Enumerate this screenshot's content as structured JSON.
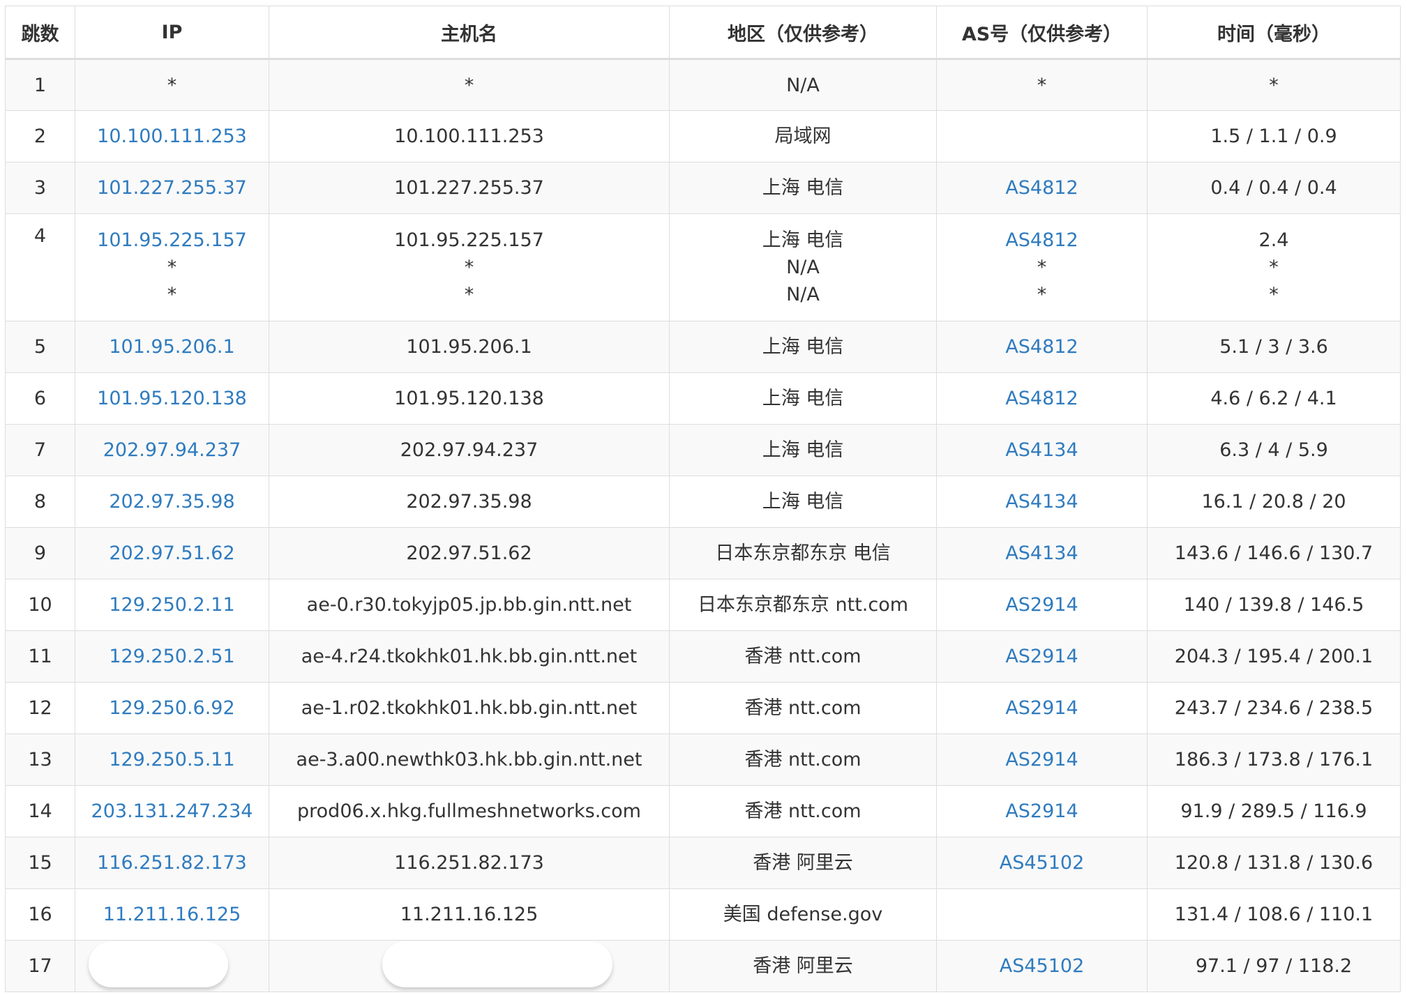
{
  "headers": [
    "跳数",
    "IP",
    "主机名",
    "地区（仅供参考）",
    "AS号（仅供参考）",
    "时间（毫秒）"
  ],
  "rows": [
    {
      "hop": "1",
      "ip": [
        "*"
      ],
      "ip_link": false,
      "host": [
        "*"
      ],
      "region": [
        "N/A"
      ],
      "asn": [
        "*"
      ],
      "asn_link": false,
      "time": [
        "*"
      ]
    },
    {
      "hop": "2",
      "ip": [
        "10.100.111.253"
      ],
      "ip_link": true,
      "host": [
        "10.100.111.253"
      ],
      "region": [
        "局域网"
      ],
      "asn": [
        ""
      ],
      "asn_link": false,
      "time": [
        "1.5 / 1.1 / 0.9"
      ]
    },
    {
      "hop": "3",
      "ip": [
        "101.227.255.37"
      ],
      "ip_link": true,
      "host": [
        "101.227.255.37"
      ],
      "region": [
        "上海 电信"
      ],
      "asn": [
        "AS4812"
      ],
      "asn_link": true,
      "time": [
        "0.4 / 0.4 / 0.4"
      ]
    },
    {
      "hop": "4",
      "ip": [
        "101.95.225.157",
        "*",
        "*"
      ],
      "ip_link": true,
      "host": [
        "101.95.225.157",
        "*",
        "*"
      ],
      "region": [
        "上海 电信",
        "N/A",
        "N/A"
      ],
      "asn": [
        "AS4812",
        "*",
        "*"
      ],
      "asn_link": true,
      "time": [
        "2.4",
        "*",
        "*"
      ]
    },
    {
      "hop": "5",
      "ip": [
        "101.95.206.1"
      ],
      "ip_link": true,
      "host": [
        "101.95.206.1"
      ],
      "region": [
        "上海 电信"
      ],
      "asn": [
        "AS4812"
      ],
      "asn_link": true,
      "time": [
        "5.1 / 3 / 3.6"
      ]
    },
    {
      "hop": "6",
      "ip": [
        "101.95.120.138"
      ],
      "ip_link": true,
      "host": [
        "101.95.120.138"
      ],
      "region": [
        "上海 电信"
      ],
      "asn": [
        "AS4812"
      ],
      "asn_link": true,
      "time": [
        "4.6 / 6.2 / 4.1"
      ]
    },
    {
      "hop": "7",
      "ip": [
        "202.97.94.237"
      ],
      "ip_link": true,
      "host": [
        "202.97.94.237"
      ],
      "region": [
        "上海 电信"
      ],
      "asn": [
        "AS4134"
      ],
      "asn_link": true,
      "time": [
        "6.3 / 4 / 5.9"
      ]
    },
    {
      "hop": "8",
      "ip": [
        "202.97.35.98"
      ],
      "ip_link": true,
      "host": [
        "202.97.35.98"
      ],
      "region": [
        "上海 电信"
      ],
      "asn": [
        "AS4134"
      ],
      "asn_link": true,
      "time": [
        "16.1 / 20.8 / 20"
      ]
    },
    {
      "hop": "9",
      "ip": [
        "202.97.51.62"
      ],
      "ip_link": true,
      "host": [
        "202.97.51.62"
      ],
      "region": [
        "日本东京都东京 电信"
      ],
      "asn": [
        "AS4134"
      ],
      "asn_link": true,
      "time": [
        "143.6 / 146.6 / 130.7"
      ]
    },
    {
      "hop": "10",
      "ip": [
        "129.250.2.11"
      ],
      "ip_link": true,
      "host": [
        "ae-0.r30.tokyjp05.jp.bb.gin.ntt.net"
      ],
      "region": [
        "日本东京都东京 ntt.com"
      ],
      "asn": [
        "AS2914"
      ],
      "asn_link": true,
      "time": [
        "140 / 139.8 / 146.5"
      ]
    },
    {
      "hop": "11",
      "ip": [
        "129.250.2.51"
      ],
      "ip_link": true,
      "host": [
        "ae-4.r24.tkokhk01.hk.bb.gin.ntt.net"
      ],
      "region": [
        "香港 ntt.com"
      ],
      "asn": [
        "AS2914"
      ],
      "asn_link": true,
      "time": [
        "204.3 / 195.4 / 200.1"
      ]
    },
    {
      "hop": "12",
      "ip": [
        "129.250.6.92"
      ],
      "ip_link": true,
      "host": [
        "ae-1.r02.tkokhk01.hk.bb.gin.ntt.net"
      ],
      "region": [
        "香港 ntt.com"
      ],
      "asn": [
        "AS2914"
      ],
      "asn_link": true,
      "time": [
        "243.7 / 234.6 / 238.5"
      ]
    },
    {
      "hop": "13",
      "ip": [
        "129.250.5.11"
      ],
      "ip_link": true,
      "host": [
        "ae-3.a00.newthk03.hk.bb.gin.ntt.net"
      ],
      "region": [
        "香港 ntt.com"
      ],
      "asn": [
        "AS2914"
      ],
      "asn_link": true,
      "time": [
        "186.3 / 173.8 / 176.1"
      ]
    },
    {
      "hop": "14",
      "ip": [
        "203.131.247.234"
      ],
      "ip_link": true,
      "host": [
        "prod06.x.hkg.fullmeshnetworks.com"
      ],
      "region": [
        "香港 ntt.com"
      ],
      "asn": [
        "AS2914"
      ],
      "asn_link": true,
      "time": [
        "91.9 / 289.5 / 116.9"
      ]
    },
    {
      "hop": "15",
      "ip": [
        "116.251.82.173"
      ],
      "ip_link": true,
      "host": [
        "116.251.82.173"
      ],
      "region": [
        "香港 阿里云"
      ],
      "asn": [
        "AS45102"
      ],
      "asn_link": true,
      "time": [
        "120.8 / 131.8 / 130.6"
      ]
    },
    {
      "hop": "16",
      "ip": [
        "11.211.16.125"
      ],
      "ip_link": true,
      "host": [
        "11.211.16.125"
      ],
      "region": [
        "美国 defense.gov"
      ],
      "asn": [
        ""
      ],
      "asn_link": false,
      "time": [
        "131.4 / 108.6 / 110.1"
      ]
    },
    {
      "hop": "17",
      "ip": [
        ""
      ],
      "ip_link": false,
      "redacted_ip": true,
      "host": [
        ""
      ],
      "redacted_host": true,
      "region": [
        "香港 阿里云"
      ],
      "asn": [
        "AS45102"
      ],
      "asn_link": true,
      "time": [
        "97.1 / 97 / 118.2"
      ]
    }
  ],
  "colors": {
    "link": "#2f7bbf",
    "text": "#333333",
    "border": "#dddddd",
    "stripe": "#f9f9f9"
  }
}
